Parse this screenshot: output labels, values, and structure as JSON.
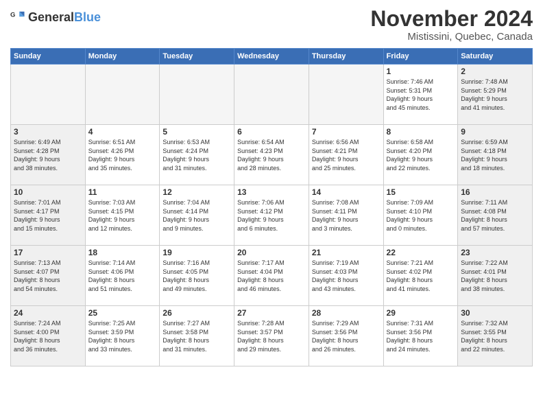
{
  "logo": {
    "general": "General",
    "blue": "Blue"
  },
  "header": {
    "month": "November 2024",
    "location": "Mistissini, Quebec, Canada"
  },
  "weekdays": [
    "Sunday",
    "Monday",
    "Tuesday",
    "Wednesday",
    "Thursday",
    "Friday",
    "Saturday"
  ],
  "weeks": [
    [
      {
        "day": "",
        "info": "",
        "empty": true
      },
      {
        "day": "",
        "info": "",
        "empty": true
      },
      {
        "day": "",
        "info": "",
        "empty": true
      },
      {
        "day": "",
        "info": "",
        "empty": true
      },
      {
        "day": "",
        "info": "",
        "empty": true
      },
      {
        "day": "1",
        "info": "Sunrise: 7:46 AM\nSunset: 5:31 PM\nDaylight: 9 hours\nand 45 minutes."
      },
      {
        "day": "2",
        "info": "Sunrise: 7:48 AM\nSunset: 5:29 PM\nDaylight: 9 hours\nand 41 minutes."
      }
    ],
    [
      {
        "day": "3",
        "info": "Sunrise: 6:49 AM\nSunset: 4:28 PM\nDaylight: 9 hours\nand 38 minutes."
      },
      {
        "day": "4",
        "info": "Sunrise: 6:51 AM\nSunset: 4:26 PM\nDaylight: 9 hours\nand 35 minutes."
      },
      {
        "day": "5",
        "info": "Sunrise: 6:53 AM\nSunset: 4:24 PM\nDaylight: 9 hours\nand 31 minutes."
      },
      {
        "day": "6",
        "info": "Sunrise: 6:54 AM\nSunset: 4:23 PM\nDaylight: 9 hours\nand 28 minutes."
      },
      {
        "day": "7",
        "info": "Sunrise: 6:56 AM\nSunset: 4:21 PM\nDaylight: 9 hours\nand 25 minutes."
      },
      {
        "day": "8",
        "info": "Sunrise: 6:58 AM\nSunset: 4:20 PM\nDaylight: 9 hours\nand 22 minutes."
      },
      {
        "day": "9",
        "info": "Sunrise: 6:59 AM\nSunset: 4:18 PM\nDaylight: 9 hours\nand 18 minutes."
      }
    ],
    [
      {
        "day": "10",
        "info": "Sunrise: 7:01 AM\nSunset: 4:17 PM\nDaylight: 9 hours\nand 15 minutes."
      },
      {
        "day": "11",
        "info": "Sunrise: 7:03 AM\nSunset: 4:15 PM\nDaylight: 9 hours\nand 12 minutes."
      },
      {
        "day": "12",
        "info": "Sunrise: 7:04 AM\nSunset: 4:14 PM\nDaylight: 9 hours\nand 9 minutes."
      },
      {
        "day": "13",
        "info": "Sunrise: 7:06 AM\nSunset: 4:12 PM\nDaylight: 9 hours\nand 6 minutes."
      },
      {
        "day": "14",
        "info": "Sunrise: 7:08 AM\nSunset: 4:11 PM\nDaylight: 9 hours\nand 3 minutes."
      },
      {
        "day": "15",
        "info": "Sunrise: 7:09 AM\nSunset: 4:10 PM\nDaylight: 9 hours\nand 0 minutes."
      },
      {
        "day": "16",
        "info": "Sunrise: 7:11 AM\nSunset: 4:08 PM\nDaylight: 8 hours\nand 57 minutes."
      }
    ],
    [
      {
        "day": "17",
        "info": "Sunrise: 7:13 AM\nSunset: 4:07 PM\nDaylight: 8 hours\nand 54 minutes."
      },
      {
        "day": "18",
        "info": "Sunrise: 7:14 AM\nSunset: 4:06 PM\nDaylight: 8 hours\nand 51 minutes."
      },
      {
        "day": "19",
        "info": "Sunrise: 7:16 AM\nSunset: 4:05 PM\nDaylight: 8 hours\nand 49 minutes."
      },
      {
        "day": "20",
        "info": "Sunrise: 7:17 AM\nSunset: 4:04 PM\nDaylight: 8 hours\nand 46 minutes."
      },
      {
        "day": "21",
        "info": "Sunrise: 7:19 AM\nSunset: 4:03 PM\nDaylight: 8 hours\nand 43 minutes."
      },
      {
        "day": "22",
        "info": "Sunrise: 7:21 AM\nSunset: 4:02 PM\nDaylight: 8 hours\nand 41 minutes."
      },
      {
        "day": "23",
        "info": "Sunrise: 7:22 AM\nSunset: 4:01 PM\nDaylight: 8 hours\nand 38 minutes."
      }
    ],
    [
      {
        "day": "24",
        "info": "Sunrise: 7:24 AM\nSunset: 4:00 PM\nDaylight: 8 hours\nand 36 minutes."
      },
      {
        "day": "25",
        "info": "Sunrise: 7:25 AM\nSunset: 3:59 PM\nDaylight: 8 hours\nand 33 minutes."
      },
      {
        "day": "26",
        "info": "Sunrise: 7:27 AM\nSunset: 3:58 PM\nDaylight: 8 hours\nand 31 minutes."
      },
      {
        "day": "27",
        "info": "Sunrise: 7:28 AM\nSunset: 3:57 PM\nDaylight: 8 hours\nand 29 minutes."
      },
      {
        "day": "28",
        "info": "Sunrise: 7:29 AM\nSunset: 3:56 PM\nDaylight: 8 hours\nand 26 minutes."
      },
      {
        "day": "29",
        "info": "Sunrise: 7:31 AM\nSunset: 3:56 PM\nDaylight: 8 hours\nand 24 minutes."
      },
      {
        "day": "30",
        "info": "Sunrise: 7:32 AM\nSunset: 3:55 PM\nDaylight: 8 hours\nand 22 minutes."
      }
    ]
  ]
}
